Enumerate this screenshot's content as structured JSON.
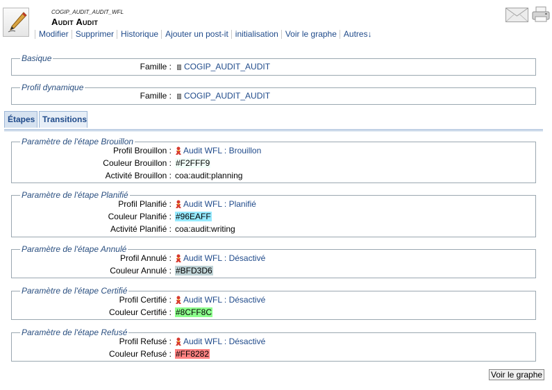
{
  "document": {
    "code": "COGIP_AUDIT_AUDIT_WFL",
    "title": "Audit Audit"
  },
  "menu": [
    "Modifier",
    "Supprimer",
    "Historique",
    "Ajouter un post-it",
    "initialisation",
    "Voir le graphe",
    "Autres↓"
  ],
  "sections": {
    "basique": {
      "legend": "Basique",
      "famille_label": "Famille :",
      "famille_value": "COGIP_AUDIT_AUDIT"
    },
    "profil_dynamique": {
      "legend": "Profil dynamique",
      "famille_label": "Famille :",
      "famille_value": "COGIP_AUDIT_AUDIT"
    }
  },
  "tabs": [
    "Étapes",
    "Transitions"
  ],
  "steps": [
    {
      "legend": "Paramètre de l'étape Brouillon",
      "profil_label": "Profil Brouillon :",
      "profil_value": "Audit WFL : Brouillon",
      "couleur_label": "Couleur Brouillon :",
      "couleur_value": "#F2FFF9",
      "color": "#F2FFF9",
      "activite_label": "Activité Brouillon :",
      "activite_value": "coa:audit:planning"
    },
    {
      "legend": "Paramètre de l'étape Planifié",
      "profil_label": "Profil Planifié :",
      "profil_value": "Audit WFL : Planifié",
      "couleur_label": "Couleur Planifié :",
      "couleur_value": "#96EAFF",
      "color": "#96EAFF",
      "activite_label": "Activité Planifié :",
      "activite_value": "coa:audit:writing"
    },
    {
      "legend": "Paramètre de l'étape Annulé",
      "profil_label": "Profil Annulé :",
      "profil_value": "Audit WFL : Désactivé",
      "couleur_label": "Couleur Annulé :",
      "couleur_value": "#BFD3D6",
      "color": "#BFD3D6"
    },
    {
      "legend": "Paramètre de l'étape Certifié",
      "profil_label": "Profil Certifié :",
      "profil_value": "Audit WFL : Désactivé",
      "couleur_label": "Couleur Certifié :",
      "couleur_value": "#8CFF8C",
      "color": "#8CFF8C"
    },
    {
      "legend": "Paramètre de l'étape Refusé",
      "profil_label": "Profil Refusé :",
      "profil_value": "Audit WFL : Désactivé",
      "couleur_label": "Couleur Refusé :",
      "couleur_value": "#FF8282",
      "color": "#FF8282"
    }
  ],
  "footer": {
    "graph_button": "Voir le graphe"
  }
}
